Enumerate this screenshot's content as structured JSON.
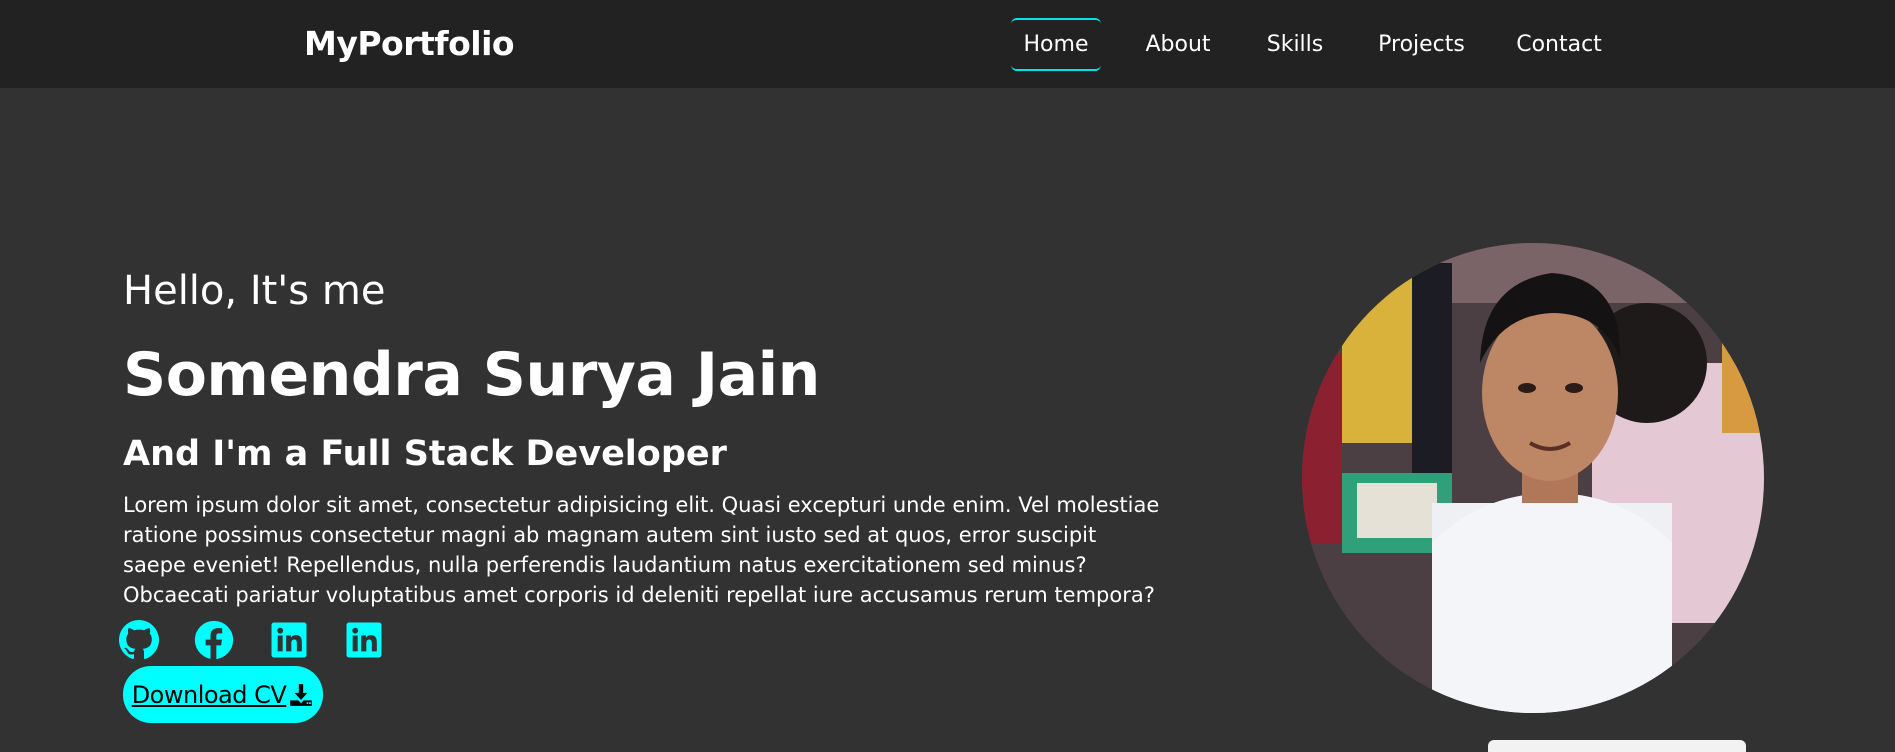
{
  "nav": {
    "brand": "MyPortfolio",
    "links": [
      {
        "label": "Home",
        "active": true
      },
      {
        "label": "About",
        "active": false
      },
      {
        "label": "Skills",
        "active": false
      },
      {
        "label": "Projects",
        "active": false
      },
      {
        "label": "Contact",
        "active": false
      }
    ]
  },
  "hero": {
    "greeting": "Hello, It's me",
    "name": "Somendra Surya Jain",
    "role": "And I'm a Full Stack Developer",
    "bio": "Lorem ipsum dolor sit amet, consectetur adipisicing elit. Quasi excepturi unde enim. Vel molestiae ratione possimus consectetur magni ab magnam autem sint iusto sed at quos, error suscipit saepe eveniet! Repellendus, nulla perferendis laudantium natus exercitationem sed minus? Obcaecati pariatur voluptatibus amet corporis id deleniti repellat iure accusamus rerum tempora?",
    "social_icons": [
      "github-icon",
      "facebook-icon",
      "linkedin-icon",
      "linkedin-icon"
    ],
    "cv_button_label": "Download CV",
    "cv_button_icon": "download-icon"
  },
  "colors": {
    "navbar_bg": "#222222",
    "page_bg": "#323232",
    "accent": "#00ffff",
    "text": "#ffffff"
  }
}
